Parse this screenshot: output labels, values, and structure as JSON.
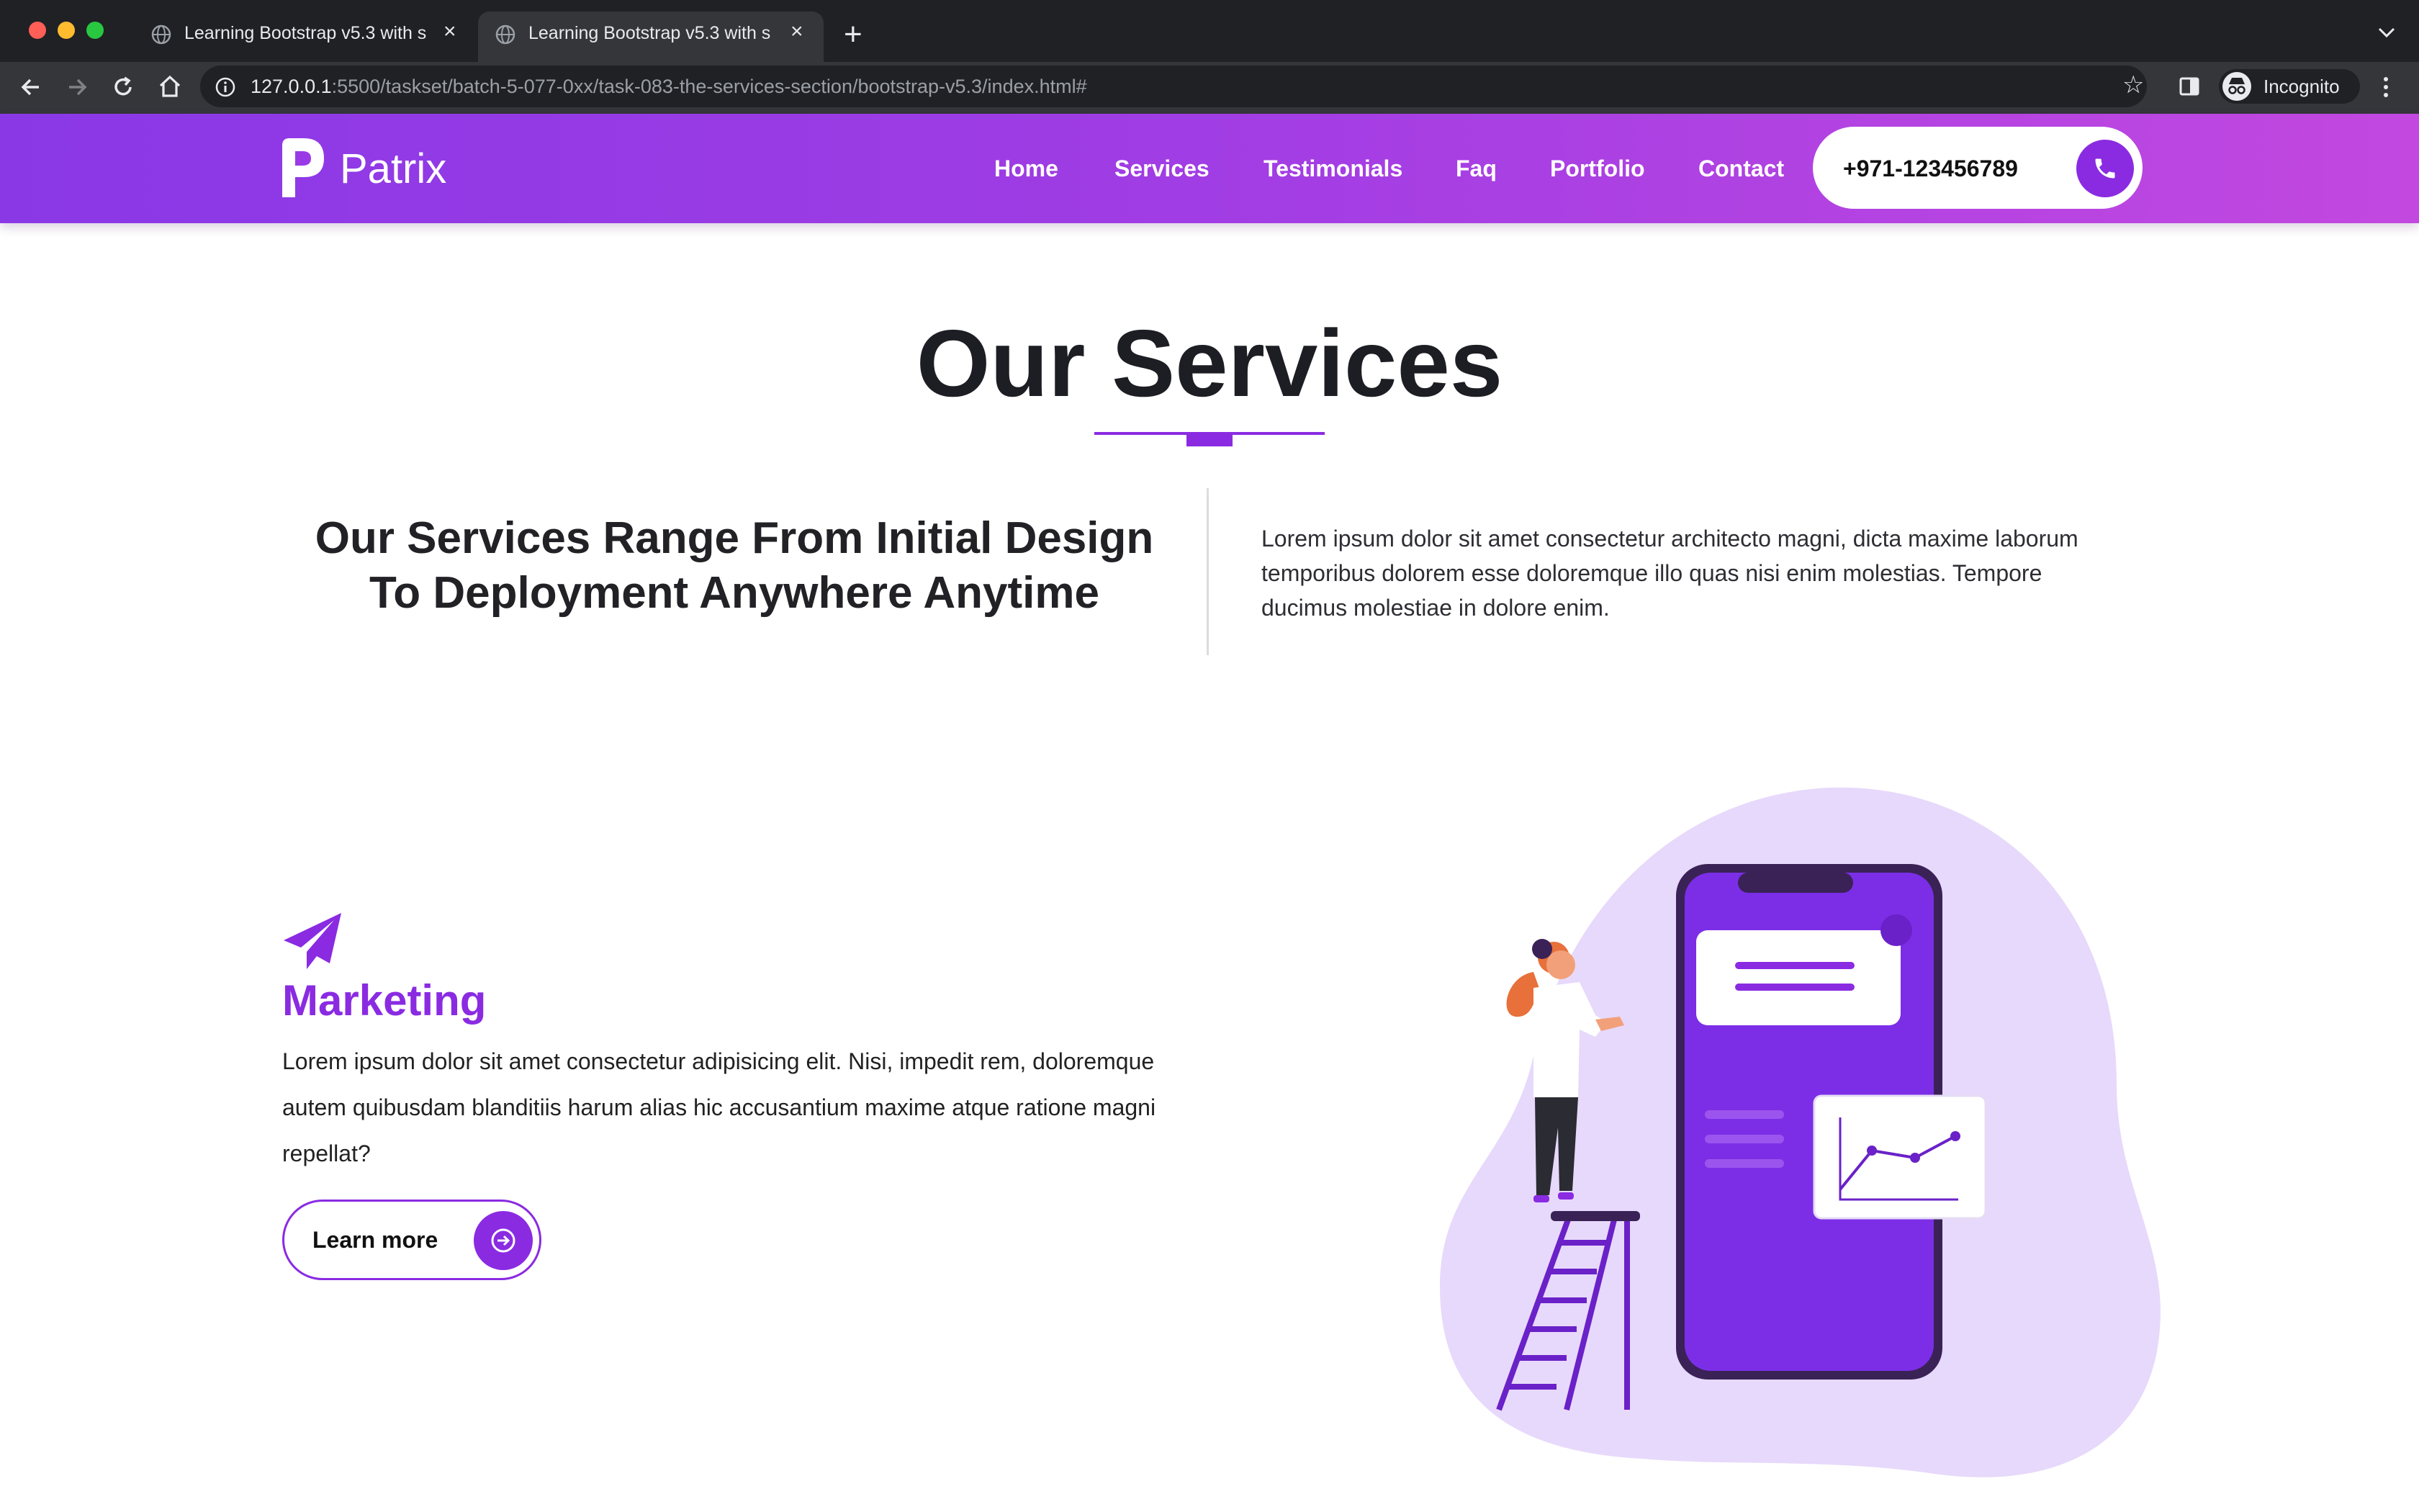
{
  "browser": {
    "tabs": [
      {
        "title": "Learning Bootstrap v5.3 with s"
      },
      {
        "title": "Learning Bootstrap v5.3 with s"
      }
    ],
    "url_host": "127.0.0.1",
    "url_rest": ":5500/taskset/batch-5-077-0xx/task-083-the-services-section/bootstrap-v5.3/index.html#",
    "profile_label": "Incognito"
  },
  "nav": {
    "brand": "Patrix",
    "links": [
      "Home",
      "Services",
      "Testimonials",
      "Faq",
      "Portfolio",
      "Contact"
    ],
    "phone": "+971-123456789"
  },
  "services": {
    "title": "Our Services",
    "subheading": "Our Services Range From Initial Design To Deployment Anywhere Anytime",
    "description": "Lorem ipsum dolor sit amet consectetur architecto magni, dicta maxime laborum temporibus dolorem esse doloremque illo quas nisi enim molestias. Tempore ducimus molestiae in dolore enim.",
    "marketing": {
      "title": "Marketing",
      "body": "Lorem ipsum dolor sit amet consectetur adipisicing elit. Nisi, impedit rem, doloremque autem quibusdam blanditiis harum alias hic accusantium maxime atque ratione magni repellat?",
      "cta": "Learn more"
    }
  },
  "colors": {
    "accent": "#8a2be2",
    "nav_gradient_start": "#8a38e6",
    "nav_gradient_end": "#c248e0",
    "blob": "#e7d9fb"
  }
}
